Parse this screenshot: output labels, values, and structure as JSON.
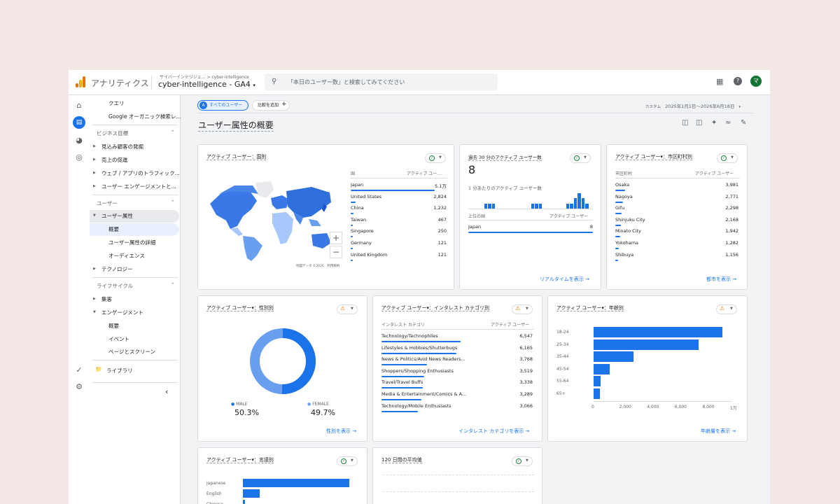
{
  "header": {
    "app_title": "アナリティクス",
    "breadcrumb": "サイバーインテリジェ... > cyber-intelligence",
    "property": "cyber-intelligence - GA4",
    "search_placeholder": "「本日のユーザー数」と検索してみてください",
    "avatar_letter": "マ"
  },
  "nav": {
    "query": "クエリ",
    "organic": "Google オーガニック検索レ...",
    "biz_heading": "ビジネス目標",
    "biz_items": [
      "見込み顧客の発掘",
      "売上の促進",
      "ウェブ / アプリのトラフィック...",
      "ユーザー エンゲージメントと..."
    ],
    "user_heading": "ユーザー",
    "user_attr": "ユーザー属性",
    "user_sub": [
      "概要",
      "ユーザー属性の詳細",
      "オーディエンス"
    ],
    "tech": "テクノロジー",
    "lifecycle_heading": "ライフサイクル",
    "acq": "集客",
    "engagement": "エンゲージメント",
    "eng_sub": [
      "概要",
      "イベント",
      "ページとスクリーン"
    ],
    "library": "ライブラリ"
  },
  "filters": {
    "all_users": "すべてのユーザー",
    "add_compare": "比較を追加",
    "date_label": "カスタム",
    "date_range": "2025年1月1日～2026年6月18日"
  },
  "page_title": "ユーザー属性の概要",
  "country_card": {
    "title": "アクティブ ユーザー：国別",
    "col1": "国",
    "col2": "アクティブ ユー...",
    "map_note": "地図データ ©2026　利用規約",
    "rows": [
      {
        "label": "Japan",
        "value": "5.1万",
        "pct": 1.0
      },
      {
        "label": "United States",
        "value": "2,824",
        "pct": 0.06
      },
      {
        "label": "China",
        "value": "1,232",
        "pct": 0.03
      },
      {
        "label": "Taiwan",
        "value": "467",
        "pct": 0.01
      },
      {
        "label": "Singapore",
        "value": "250",
        "pct": 0.005
      },
      {
        "label": "Germany",
        "value": "121",
        "pct": 0.003
      },
      {
        "label": "United Kingdom",
        "value": "121",
        "pct": 0.003
      }
    ]
  },
  "realtime_card": {
    "title": "過去 30 分のアクティブ ユーザー数",
    "value": "8",
    "sub_title": "1 分あたりのアクティブ ユーザー数",
    "col1": "上位の国",
    "col2": "アクティブ ユーザー",
    "row_label": "Japan",
    "row_value": "8",
    "link": "リアルタイムを表示",
    "minute_bars": [
      0,
      0,
      0,
      0,
      1,
      1,
      1,
      0,
      0,
      0,
      0,
      0,
      0,
      0,
      0,
      0,
      1,
      1,
      1,
      0,
      0,
      0,
      0,
      0,
      0,
      1,
      1,
      2,
      3,
      2,
      1,
      0
    ]
  },
  "city_card": {
    "title": "アクティブ ユーザー▾：市区町村別",
    "col1": "市区町村",
    "col2": "アクティブ ユーザー",
    "link": "都市を表示",
    "rows": [
      {
        "label": "Osaka",
        "value": "3,981",
        "pct": 0.08
      },
      {
        "label": "Nagoya",
        "value": "2,771",
        "pct": 0.06
      },
      {
        "label": "Gifu",
        "value": "2,298",
        "pct": 0.05
      },
      {
        "label": "Shinjuku City",
        "value": "2,168",
        "pct": 0.045
      },
      {
        "label": "Minato City",
        "value": "1,942",
        "pct": 0.04
      },
      {
        "label": "Yokohama",
        "value": "1,282",
        "pct": 0.03
      },
      {
        "label": "Shibuya",
        "value": "1,156",
        "pct": 0.025
      }
    ]
  },
  "gender_card": {
    "title": "アクティブ ユーザー▾：性別別",
    "male_label": "MALE",
    "male_value": "50.3%",
    "female_label": "FEMALE",
    "female_value": "49.7%",
    "male_pct": 50.3,
    "link": "性別を表示"
  },
  "interest_card": {
    "title": "アクティブ ユーザー▾：インタレスト カテゴリ別",
    "col1": "インタレスト カテゴリ",
    "col2": "アクティブ ユーザー",
    "link": "インタレスト カテゴリを表示",
    "rows": [
      {
        "label": "Technology/Technophiles",
        "value": "6,547",
        "pct": 0.52
      },
      {
        "label": "Lifestyles & Hobbies/Shutterbugs",
        "value": "6,165",
        "pct": 0.49
      },
      {
        "label": "News & Politics/Avid News Readers...",
        "value": "3,768",
        "pct": 0.3
      },
      {
        "label": "Shoppers/Shopping Enthusiasts",
        "value": "3,519",
        "pct": 0.28
      },
      {
        "label": "Travel/Travel Buffs",
        "value": "3,338",
        "pct": 0.27
      },
      {
        "label": "Media & Entertainment/Comics & A...",
        "value": "3,289",
        "pct": 0.26
      },
      {
        "label": "Technology/Mobile Enthusiasts",
        "value": "3,066",
        "pct": 0.24
      }
    ]
  },
  "age_card": {
    "title": "アクティブ ユーザー▾：年齢別",
    "link": "年齢層を表示",
    "categories": [
      "18-24",
      "25-34",
      "35-44",
      "45-54",
      "55-64",
      "65+"
    ],
    "values": [
      9300,
      7600,
      2900,
      1150,
      520,
      430
    ],
    "xmax": 10000,
    "ticks": [
      "0",
      "2,000",
      "4,000",
      "6,000",
      "8,000",
      "1万"
    ]
  },
  "language_card": {
    "title": "アクティブ ユーザー▾：言語別",
    "categories": [
      "Japanese",
      "English",
      "Chinese"
    ],
    "values": [
      1.0,
      0.16,
      0.02
    ]
  },
  "avg120_card": {
    "title": "120 日間の平均値"
  }
}
